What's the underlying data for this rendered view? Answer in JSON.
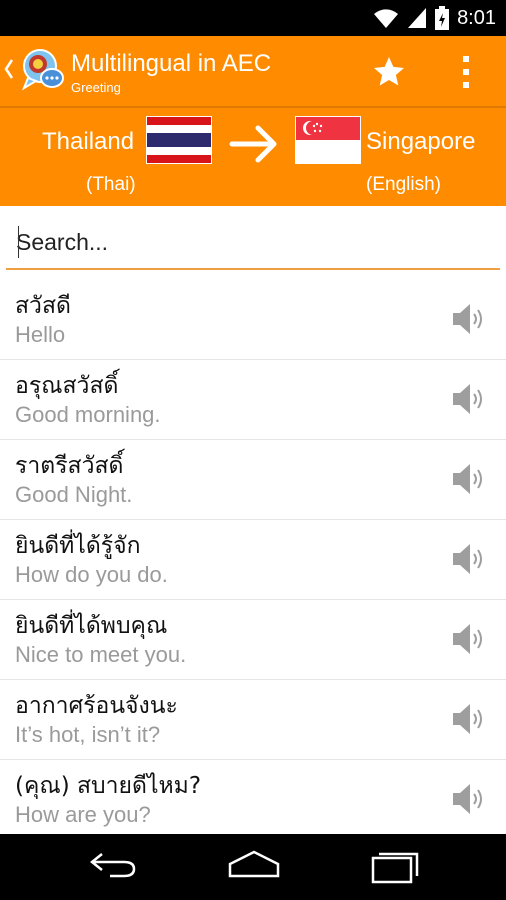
{
  "status_bar": {
    "time": "8:01",
    "icons": [
      "wifi-icon",
      "signal-icon",
      "battery-icon"
    ]
  },
  "app_bar": {
    "title": "Multilingual in AEC",
    "subtitle": "Greeting",
    "actions": [
      "star-icon",
      "overflow-menu-icon"
    ],
    "color": "#FF8C00"
  },
  "languages": {
    "from": {
      "country": "Thailand",
      "language": "(Thai)",
      "flag": "thailand-flag"
    },
    "to": {
      "country": "Singapore",
      "language": "(English)",
      "flag": "singapore-flag"
    }
  },
  "search": {
    "placeholder": "Search..."
  },
  "phrases": [
    {
      "thai": "สวัสดี",
      "english": "Hello"
    },
    {
      "thai": "อรุณสวัสดิ์",
      "english": "Good morning."
    },
    {
      "thai": "ราตรีสวัสดิ์",
      "english": "Good Night."
    },
    {
      "thai": "ยินดีที่ได้รู้จัก",
      "english": "How do you do."
    },
    {
      "thai": "ยินดีที่ได้พบคุณ",
      "english": "Nice to meet you."
    },
    {
      "thai": "อากาศร้อนจังนะ",
      "english": "It’s hot, isn’t it?"
    },
    {
      "thai": "(คุณ) สบายดีไหม?",
      "english": "How are you?"
    }
  ],
  "nav_bar": [
    "back-icon",
    "home-icon",
    "recent-apps-icon"
  ]
}
